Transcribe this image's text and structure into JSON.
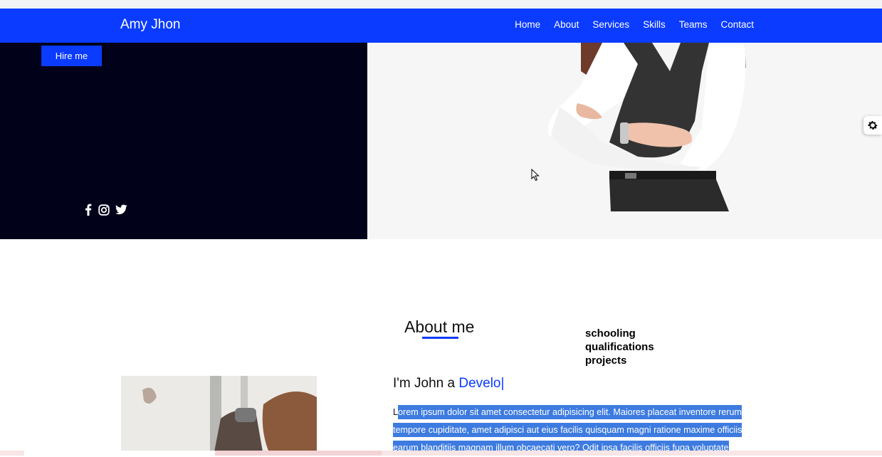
{
  "header": {
    "brand": "Amy Jhon",
    "nav": [
      "Home",
      "About",
      "Services",
      "Skills",
      "Teams",
      "Contact"
    ]
  },
  "hero": {
    "hire_label": "Hire me",
    "social_icons": [
      "facebook-icon",
      "instagram-icon",
      "twitter-icon"
    ]
  },
  "about": {
    "title": "About me",
    "tabs": [
      "schooling",
      "qualifications",
      "projects"
    ],
    "intro_prefix": "I'm John a ",
    "intro_role": "Develo",
    "intro_caret": "|",
    "paragraph_first": "L",
    "paragraph_rest": "orem ipsum dolor sit amet consectetur adipisicing elit. Maiores placeat inventore rerum tempore cupiditate, amet adipisci aut eius facilis quisquam magni ratione maxime officiis earum blanditiis magnam illum obcaecati vero? Odit ipsa facilis officiis fuga voluptate"
  },
  "colors": {
    "accent": "#0a3bff",
    "hero_dark": "#01011a",
    "selection": "#3d7be0"
  }
}
